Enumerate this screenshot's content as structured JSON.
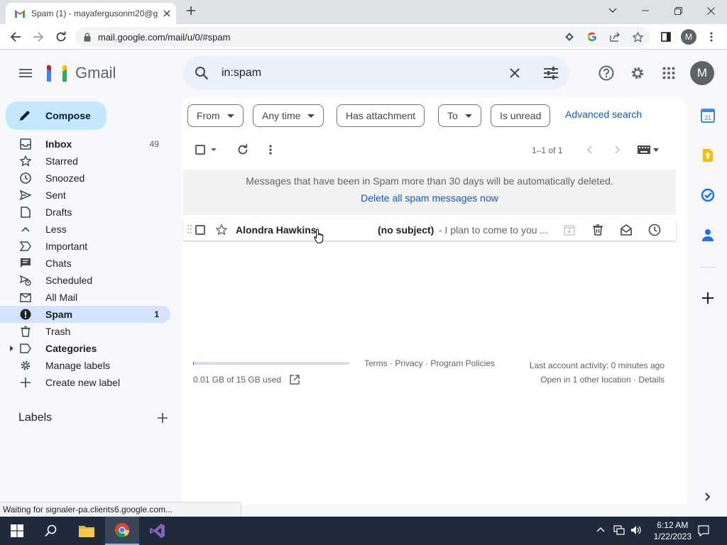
{
  "browser": {
    "tab_title": "Spam (1) - mayafergusonm20@g",
    "url": "mail.google.com/mail/u/0/#spam",
    "profile_initial": "M",
    "status_text": "Waiting for signaler-pa.clients6.google.com..."
  },
  "gmail": {
    "logo_text": "Gmail",
    "search_query": "in:spam",
    "account_initial": "M",
    "compose_label": "Compose",
    "nav": [
      {
        "label": "Inbox",
        "count": "49",
        "icon": "inbox-icon",
        "bold": true
      },
      {
        "label": "Starred",
        "count": "",
        "icon": "star-icon"
      },
      {
        "label": "Snoozed",
        "count": "",
        "icon": "clock-icon"
      },
      {
        "label": "Sent",
        "count": "",
        "icon": "send-icon"
      },
      {
        "label": "Drafts",
        "count": "",
        "icon": "draft-icon"
      },
      {
        "label": "Less",
        "count": "",
        "icon": "chevron-up-icon"
      },
      {
        "label": "Important",
        "count": "",
        "icon": "important-icon"
      },
      {
        "label": "Chats",
        "count": "",
        "icon": "chat-icon"
      },
      {
        "label": "Scheduled",
        "count": "",
        "icon": "scheduled-icon"
      },
      {
        "label": "All Mail",
        "count": "",
        "icon": "all-mail-icon"
      },
      {
        "label": "Spam",
        "count": "1",
        "icon": "spam-icon",
        "bold": true,
        "active": true
      },
      {
        "label": "Trash",
        "count": "",
        "icon": "trash-icon"
      },
      {
        "label": "Categories",
        "count": "",
        "icon": "label-icon",
        "bold": true
      },
      {
        "label": "Manage labels",
        "count": "",
        "icon": "gear-icon"
      },
      {
        "label": "Create new label",
        "count": "",
        "icon": "plus-icon"
      }
    ],
    "labels_heading": "Labels",
    "filters": {
      "from": "From",
      "any_time": "Any time",
      "has_attachment": "Has attachment",
      "to": "To",
      "is_unread": "Is unread",
      "advanced_search": "Advanced search"
    },
    "pagination": "1–1 of 1",
    "banner_message": "Messages that have been in Spam more than 30 days will be automatically deleted.",
    "banner_link": "Delete all spam messages now",
    "messages": [
      {
        "sender": "Alondra Hawkins",
        "subject": "(no subject)",
        "snippet": "- I plan to come to you ..."
      }
    ],
    "footer": {
      "storage": "0.01 GB of 15 GB used",
      "storage_fraction": 0.001,
      "links": "Terms · Privacy · Program Policies",
      "activity": "Last account activity: 0 minutes ago",
      "location": "Open in 1 other location · Details"
    }
  },
  "taskbar": {
    "time": "6:12 AM",
    "date": "1/22/2023"
  },
  "colors": {
    "accent_blue": "#0b57d0",
    "compose_bg": "#c2e7ff",
    "active_nav_bg": "#d3e3fd",
    "search_bg": "#eaf1fb"
  }
}
